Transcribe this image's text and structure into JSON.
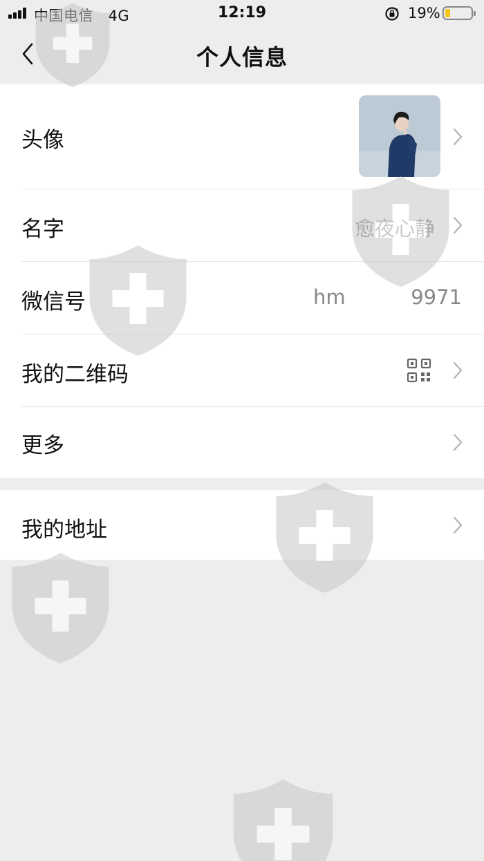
{
  "status_bar": {
    "carrier": "中国电信",
    "network": "4G",
    "time": "12:19",
    "battery_percent": "19%",
    "battery_level": 0.19,
    "battery_color": "#f5c518"
  },
  "nav": {
    "title": "个人信息",
    "back_icon": "chevron-left-icon"
  },
  "profile_rows": [
    {
      "label": "头像",
      "icon": "avatar-image"
    },
    {
      "label": "名字",
      "value": "愈夜心静"
    },
    {
      "label": "微信号",
      "value_prefix": "hm",
      "value_suffix": "9971"
    },
    {
      "label": "我的二维码",
      "icon": "qr-code-icon"
    },
    {
      "label": "更多"
    }
  ],
  "address_rows": [
    {
      "label": "我的地址"
    }
  ],
  "colors": {
    "background": "#ededed",
    "card": "#ffffff",
    "secondary_text": "#888888",
    "chevron": "#b2b2b2"
  }
}
